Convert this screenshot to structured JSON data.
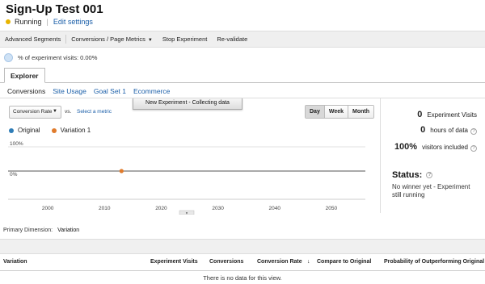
{
  "header": {
    "title": "Sign-Up Test 001",
    "status": "Running",
    "edit_settings": "Edit settings"
  },
  "toolbar": {
    "advanced_segments": "Advanced Segments",
    "conversions_metrics": "Conversions / Page Metrics",
    "stop_experiment": "Stop Experiment",
    "revalidate": "Re-validate"
  },
  "visits_pct": "% of experiment visits: 0.00%",
  "tabs": {
    "explorer": "Explorer"
  },
  "subtabs": [
    "Conversions",
    "Site Usage",
    "Goal Set 1",
    "Ecommerce"
  ],
  "controls": {
    "metric": "Conversion Rate",
    "vs": "vs.",
    "select_metric": "Select a metric",
    "collecting": "New Experiment - Collecting data",
    "granularity": [
      "Day",
      "Week",
      "Month"
    ],
    "active_granularity": "Day"
  },
  "legend": {
    "original": "Original",
    "variation": "Variation 1"
  },
  "colors": {
    "original": "#2f7db7",
    "variation": "#e07b2c",
    "status_dot": "#e8b400",
    "link": "#1a5ea8"
  },
  "chart_data": {
    "type": "line",
    "x_ticks": [
      "2000",
      "2010",
      "2020",
      "2030",
      "2040",
      "2050"
    ],
    "y_ticks": [
      "100%",
      "0%"
    ],
    "ylim": [
      0,
      1
    ],
    "xlim": [
      1993,
      2056
    ],
    "series": [
      {
        "name": "Variation 1",
        "points": [
          {
            "x": 2013,
            "y": 0
          }
        ]
      }
    ]
  },
  "summary": {
    "experiment_visits": {
      "value": "0",
      "label": "Experiment Visits"
    },
    "hours": {
      "value": "0",
      "label": "hours of data"
    },
    "visitors": {
      "value": "100%",
      "label": "visitors included"
    },
    "status_title": "Status:",
    "status_text": "No winner yet - Experiment still running"
  },
  "table": {
    "primary_dimension_label": "Primary Dimension:",
    "primary_dimension_value": "Variation",
    "columns": [
      "Variation",
      "Experiment Visits",
      "Conversions",
      "Conversion Rate",
      "Compare to Original",
      "Probability of Outperforming Original"
    ],
    "empty": "There is no data for this view."
  }
}
